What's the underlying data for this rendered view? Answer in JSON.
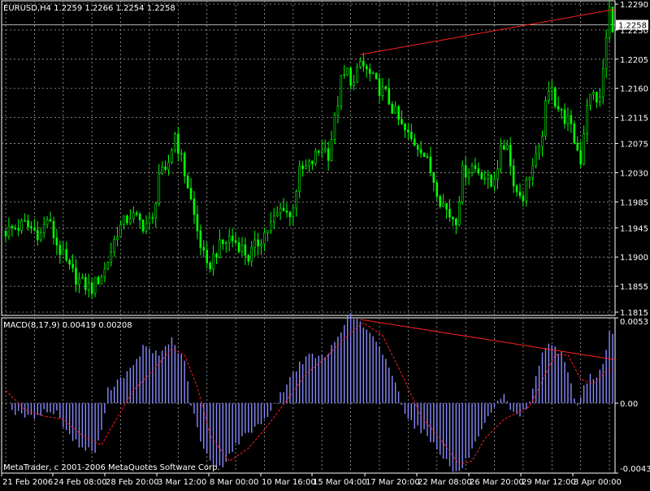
{
  "colors": {
    "background": "#000000",
    "grid": "#a0a0a0",
    "frame": "#ffffff",
    "candle": "#00ff00",
    "histogram": "#8a8aff",
    "signal": "#ff2020",
    "trendline": "#ff2020",
    "price_line": "#b0b0b0",
    "text": "#ffffff"
  },
  "chart_data": [
    {
      "type": "candlestick",
      "title": "EURUSD,H4  1.2259 1.2266 1.2254 1.2258",
      "current_price_label": "1.2258",
      "current_price": 1.2258,
      "ylim": [
        1.181,
        1.2295
      ],
      "yticks": [
        {
          "label": "1.2290",
          "value": 1.229
        },
        {
          "label": "1.2250",
          "value": 1.225
        },
        {
          "label": "1.2205",
          "value": 1.2205
        },
        {
          "label": "1.2160",
          "value": 1.216
        },
        {
          "label": "1.2115",
          "value": 1.2115
        },
        {
          "label": "1.2075",
          "value": 1.2075
        },
        {
          "label": "1.2030",
          "value": 1.203
        },
        {
          "label": "1.1985",
          "value": 1.1985
        },
        {
          "label": "1.1945",
          "value": 1.1945
        },
        {
          "label": "1.1900",
          "value": 1.19
        },
        {
          "label": "1.1855",
          "value": 1.1855
        },
        {
          "label": "1.1815",
          "value": 1.1815
        }
      ],
      "price_path": [
        [
          0,
          1.194
        ],
        [
          6,
          1.195
        ],
        [
          11,
          1.1935
        ],
        [
          13,
          1.196
        ],
        [
          16,
          1.192
        ],
        [
          20,
          1.188
        ],
        [
          24,
          1.1858
        ],
        [
          27,
          1.1852
        ],
        [
          31,
          1.188
        ],
        [
          35,
          1.194
        ],
        [
          39,
          1.1965
        ],
        [
          43,
          1.195
        ],
        [
          46,
          1.1955
        ],
        [
          48,
          1.203
        ],
        [
          50,
          1.2025
        ],
        [
          53,
          1.209
        ],
        [
          57,
          1.201
        ],
        [
          60,
          1.194
        ],
        [
          63,
          1.188
        ],
        [
          66,
          1.191
        ],
        [
          70,
          1.193
        ],
        [
          73,
          1.192
        ],
        [
          76,
          1.19
        ],
        [
          80,
          1.193
        ],
        [
          83,
          1.195
        ],
        [
          87,
          1.198
        ],
        [
          89,
          1.196
        ],
        [
          92,
          1.203
        ],
        [
          95,
          1.204
        ],
        [
          99,
          1.207
        ],
        [
          101,
          1.206
        ],
        [
          103,
          1.211
        ],
        [
          105,
          1.217
        ],
        [
          107,
          1.2185
        ],
        [
          109,
          1.2165
        ],
        [
          111,
          1.22
        ],
        [
          114,
          1.218
        ],
        [
          116,
          1.2165
        ],
        [
          119,
          1.215
        ],
        [
          122,
          1.212
        ],
        [
          124,
          1.21
        ],
        [
          127,
          1.208
        ],
        [
          130,
          1.207
        ],
        [
          134,
          1.202
        ],
        [
          136,
          1.199
        ],
        [
          139,
          1.1965
        ],
        [
          141,
          1.196
        ],
        [
          143,
          1.203
        ],
        [
          146,
          1.204
        ],
        [
          149,
          1.203
        ],
        [
          152,
          1.201
        ],
        [
          155,
          1.206
        ],
        [
          157,
          1.208
        ],
        [
          158,
          1.204
        ],
        [
          160,
          1.2
        ],
        [
          162,
          1.1995
        ],
        [
          164,
          1.203
        ],
        [
          167,
          1.206
        ],
        [
          169,
          1.213
        ],
        [
          171,
          1.217
        ],
        [
          172,
          1.214
        ],
        [
          174,
          1.212
        ],
        [
          176,
          1.211
        ],
        [
          178,
          1.208
        ],
        [
          180,
          1.205
        ],
        [
          182,
          1.214
        ],
        [
          184,
          1.215
        ],
        [
          186,
          1.214
        ],
        [
          187,
          1.219
        ],
        [
          189,
          1.228
        ],
        [
          190,
          1.2258
        ]
      ],
      "trendline": {
        "from": [
          111,
          1.2212
        ],
        "to": [
          190,
          1.2282
        ]
      }
    },
    {
      "type": "bar",
      "title": "MACD(8,17,9) 0.00419 0.00208",
      "ylim": [
        -0.00434,
        0.0053
      ],
      "yticks": [
        {
          "label": "0.0053",
          "value": 0.0053
        },
        {
          "label": "0.00",
          "value": 0
        },
        {
          "label": "-0.00434",
          "value": -0.00434
        }
      ],
      "histogram_path": [
        [
          0,
          0.0002
        ],
        [
          3,
          -0.0006
        ],
        [
          8,
          -0.0009
        ],
        [
          12,
          -0.0005
        ],
        [
          16,
          -0.0006
        ],
        [
          20,
          -0.002
        ],
        [
          24,
          -0.0028
        ],
        [
          28,
          -0.003
        ],
        [
          30,
          -0.0018
        ],
        [
          32,
          0.0008
        ],
        [
          36,
          0.0016
        ],
        [
          40,
          0.0022
        ],
        [
          43,
          0.0035
        ],
        [
          48,
          0.003
        ],
        [
          52,
          0.004
        ],
        [
          56,
          0.0025
        ],
        [
          58,
          0.0
        ],
        [
          61,
          -0.0024
        ],
        [
          65,
          -0.004
        ],
        [
          68,
          -0.0038
        ],
        [
          72,
          -0.0026
        ],
        [
          76,
          -0.0018
        ],
        [
          80,
          -0.0012
        ],
        [
          84,
          -0.0002
        ],
        [
          88,
          0.0012
        ],
        [
          92,
          0.0025
        ],
        [
          96,
          0.003
        ],
        [
          100,
          0.0028
        ],
        [
          104,
          0.0042
        ],
        [
          106,
          0.005
        ],
        [
          108,
          0.0055
        ],
        [
          111,
          0.005
        ],
        [
          115,
          0.004
        ],
        [
          119,
          0.0028
        ],
        [
          122,
          0.0012
        ],
        [
          125,
          -0.0005
        ],
        [
          128,
          -0.0014
        ],
        [
          131,
          -0.0018
        ],
        [
          134,
          -0.0025
        ],
        [
          137,
          -0.0033
        ],
        [
          140,
          -0.0042
        ],
        [
          142,
          -0.0043
        ],
        [
          144,
          -0.0036
        ],
        [
          148,
          -0.0022
        ],
        [
          151,
          -0.001
        ],
        [
          154,
          0.0
        ],
        [
          156,
          0.0004
        ],
        [
          158,
          -0.0003
        ],
        [
          161,
          -0.0008
        ],
        [
          164,
          0.0
        ],
        [
          167,
          0.0025
        ],
        [
          169,
          0.0035
        ],
        [
          171,
          0.0038
        ],
        [
          174,
          0.003
        ],
        [
          176,
          0.0018
        ],
        [
          179,
          -0.0002
        ],
        [
          181,
          0.001
        ],
        [
          183,
          0.0018
        ],
        [
          185,
          0.0015
        ],
        [
          187,
          0.0025
        ],
        [
          189,
          0.0044
        ],
        [
          190,
          0.0042
        ]
      ],
      "signal_path": [
        [
          0,
          0.0008
        ],
        [
          6,
          -0.0004
        ],
        [
          12,
          -0.0008
        ],
        [
          18,
          -0.001
        ],
        [
          24,
          -0.002
        ],
        [
          30,
          -0.0026
        ],
        [
          34,
          -0.0012
        ],
        [
          40,
          0.0008
        ],
        [
          46,
          0.002
        ],
        [
          52,
          0.0034
        ],
        [
          56,
          0.003
        ],
        [
          60,
          0.001
        ],
        [
          64,
          -0.002
        ],
        [
          70,
          -0.0036
        ],
        [
          76,
          -0.0028
        ],
        [
          82,
          -0.0014
        ],
        [
          88,
          0.0002
        ],
        [
          94,
          0.0018
        ],
        [
          100,
          0.0028
        ],
        [
          106,
          0.004
        ],
        [
          112,
          0.005
        ],
        [
          118,
          0.0042
        ],
        [
          124,
          0.0018
        ],
        [
          130,
          -0.0008
        ],
        [
          136,
          -0.0022
        ],
        [
          142,
          -0.0038
        ],
        [
          146,
          -0.0036
        ],
        [
          150,
          -0.0022
        ],
        [
          156,
          -0.001
        ],
        [
          160,
          -0.0006
        ],
        [
          164,
          -0.0002
        ],
        [
          168,
          0.0014
        ],
        [
          172,
          0.003
        ],
        [
          176,
          0.003
        ],
        [
          180,
          0.0015
        ],
        [
          184,
          0.0012
        ],
        [
          188,
          0.002
        ],
        [
          190,
          0.0021
        ]
      ],
      "trendline": {
        "from": [
          111,
          0.0052
        ],
        "to": [
          190,
          0.0027
        ]
      }
    }
  ],
  "x_axis": {
    "tick_bars": [
      0,
      18,
      36,
      54,
      72,
      90,
      110,
      128,
      146,
      164,
      182
    ],
    "labels": [
      "21 Feb 2006",
      "24 Feb 08:00",
      "28 Feb 20:00",
      "3 Mar 12:00",
      "8 Mar 00:00",
      "10 Mar 16:00",
      "15 Mar 04:00",
      "17 Mar 20:00",
      "22 Mar 08:00",
      "26 Mar 20:00",
      "29 Mar 12:00",
      "3 Apr 00:00"
    ]
  },
  "watermark": "MetaTrader, c 2001-2006 MetaQuotes Software Corp."
}
